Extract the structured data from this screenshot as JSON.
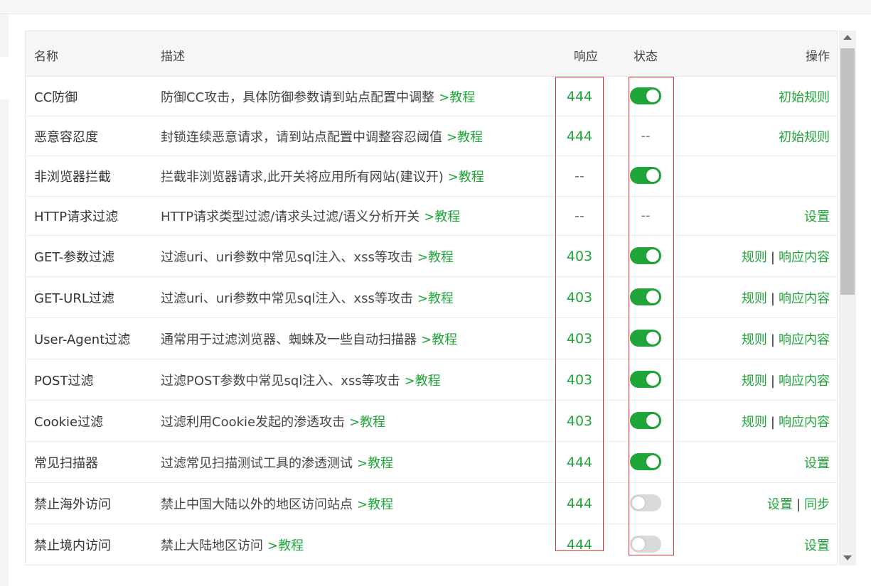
{
  "table": {
    "headers": {
      "name": "名称",
      "desc": "描述",
      "response": "响应",
      "state": "状态",
      "ops": "操作"
    },
    "rows": [
      {
        "name": "CC防御",
        "desc": "防御CC攻击，具体防御参数请到站点配置中调整",
        "link": ">教程",
        "response": "444",
        "state": "on",
        "ops": [
          "初始规则"
        ]
      },
      {
        "name": "恶意容忍度",
        "desc": "封锁连续恶意请求，请到站点配置中调整容忍阈值",
        "link": ">教程",
        "response": "444",
        "state": "--",
        "ops": [
          "初始规则"
        ]
      },
      {
        "name": "非浏览器拦截",
        "desc": "拦截非浏览器请求,此开关将应用所有网站(建议开)",
        "link": ">教程",
        "response": "--",
        "state": "on",
        "ops": []
      },
      {
        "name": "HTTP请求过滤",
        "desc": "HTTP请求类型过滤/请求头过滤/语义分析开关",
        "link": ">教程",
        "response": "--",
        "state": "--",
        "ops": [
          "设置"
        ]
      },
      {
        "name": "GET-参数过滤",
        "desc": "过滤uri、uri参数中常见sql注入、xss等攻击",
        "link": ">教程",
        "response": "403",
        "state": "on",
        "ops": [
          "规则",
          "响应内容"
        ]
      },
      {
        "name": "GET-URL过滤",
        "desc": "过滤uri、uri参数中常见sql注入、xss等攻击",
        "link": ">教程",
        "response": "403",
        "state": "on",
        "ops": [
          "规则",
          "响应内容"
        ]
      },
      {
        "name": "User-Agent过滤",
        "desc": "通常用于过滤浏览器、蜘蛛及一些自动扫描器",
        "link": ">教程",
        "response": "403",
        "state": "on",
        "ops": [
          "规则",
          "响应内容"
        ]
      },
      {
        "name": "POST过滤",
        "desc": "过滤POST参数中常见sql注入、xss等攻击",
        "link": ">教程",
        "response": "403",
        "state": "on",
        "ops": [
          "规则",
          "响应内容"
        ]
      },
      {
        "name": "Cookie过滤",
        "desc": "过滤利用Cookie发起的渗透攻击",
        "link": ">教程",
        "response": "403",
        "state": "on",
        "ops": [
          "规则",
          "响应内容"
        ]
      },
      {
        "name": "常见扫描器",
        "desc": "过滤常见扫描测试工具的渗透测试",
        "link": ">教程",
        "response": "444",
        "state": "on",
        "ops": [
          "设置"
        ]
      },
      {
        "name": "禁止海外访问",
        "desc": "禁止中国大陆以外的地区访问站点",
        "link": ">教程",
        "response": "444",
        "state": "off",
        "ops": [
          "设置",
          "同步"
        ]
      },
      {
        "name": "禁止境内访问",
        "desc": "禁止大陆地区访问",
        "link": ">教程",
        "response": "444",
        "state": "off",
        "ops": [
          "设置"
        ]
      }
    ],
    "ops_separator": "|"
  },
  "colors": {
    "accent": "#20a53a",
    "highlight_box": "#e13030",
    "toggle_off": "#d9d9d9"
  }
}
